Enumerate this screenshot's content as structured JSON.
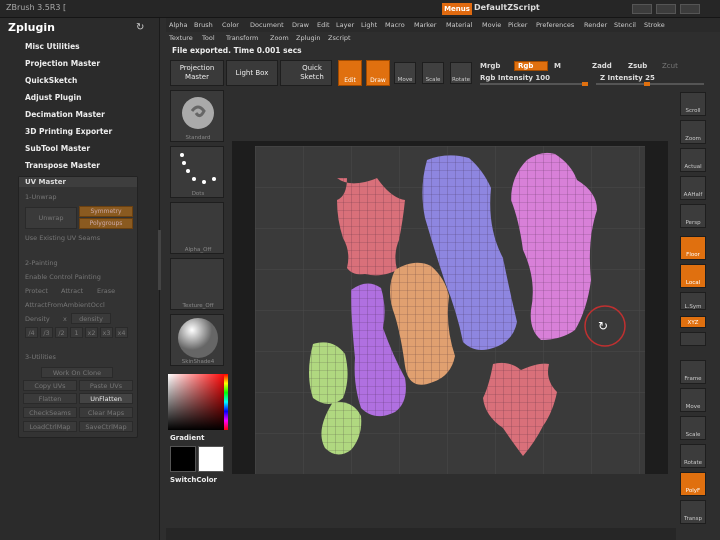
{
  "app": {
    "title": "ZBrush 3.5R3  [",
    "menus": "Menus",
    "defaultz": "DefaultZScript"
  },
  "sidebar": {
    "title": "Zplugin",
    "items": [
      "Misc Utilities",
      "Projection Master",
      "QuickSketch",
      "Adjust Plugin",
      "Decimation Master",
      "3D Printing Exporter",
      "SubTool Master",
      "Transpose Master"
    ]
  },
  "uv": {
    "title": "UV Master",
    "section1": "1-Unwrap",
    "unwrap": "Unwrap",
    "symmetry": "Symmetry",
    "polygroups": "Polygroups",
    "use_existing": "Use Existing UV Seams",
    "section2": "2-Painting",
    "enable_cp": "Enable Control Painting",
    "protect": "Protect",
    "attract": "Attract",
    "erase": "Erase",
    "attract_ao": "AttractFromAmbientOccl",
    "density": "Density",
    "x": "x",
    "density2": "density",
    "density_vals": [
      "/4",
      "/3",
      "/2",
      "1",
      "x2",
      "x3",
      "x4"
    ],
    "section3": "3-Utilities",
    "work_on_clone": "Work On Clone",
    "copy_uvs": "Copy UVs",
    "paste_uvs": "Paste UVs",
    "flatten": "Flatten",
    "unflatten": "UnFlatten",
    "checkseams": "CheckSeams",
    "clear_maps": "Clear Maps",
    "loadctrl": "LoadCtrlMap",
    "savectrl": "SaveCtrlMap"
  },
  "menu1": [
    "Alpha",
    "Brush",
    "Color",
    "Document",
    "Draw",
    "Edit",
    "Layer",
    "Light",
    "Macro",
    "Marker",
    "Material",
    "Movie",
    "Picker",
    "Preferences",
    "Render",
    "Stencil",
    "Stroke"
  ],
  "menu2": [
    "Texture",
    "Tool",
    "Transform",
    "Zoom",
    "Zplugin",
    "Zscript"
  ],
  "status": "File exported. Time 0.001 secs",
  "toolbar": {
    "projection": "Projection\nMaster",
    "lightbox": "Light Box",
    "quicksketch": "Quick\nSketch",
    "edit": "Edit",
    "draw": "Draw",
    "move": "Move",
    "scale": "Scale",
    "rotate": "Rotate",
    "mrgb": "Mrgb",
    "rgb": "Rgb",
    "m": "M",
    "zadd": "Zadd",
    "zsub": "Zsub",
    "zcut": "Zcut",
    "rgb_int": "Rgb Intensity 100",
    "z_int": "Z Intensity 25"
  },
  "tray": {
    "standard": "Standard",
    "dots": "Dots",
    "alpha_off": "Alpha_Off",
    "texture_off": "Texture_Off",
    "skinshade": "SkinShade4",
    "gradient": "Gradient",
    "switchcolor": "SwitchColor"
  },
  "right": [
    "Scroll",
    "Zoom",
    "Actual",
    "AAHalf",
    "Persp",
    "Floor",
    "Local",
    "L.Sym",
    "XYZ",
    "",
    "Frame",
    "Move",
    "Scale",
    "Rotate",
    "PolyF",
    "Transp"
  ],
  "colors": {
    "accent": "#e0700f",
    "uv_red": "#d9707a",
    "uv_purple": "#8e86e0",
    "uv_orange": "#e0a070",
    "uv_pink": "#d880d8",
    "uv_green": "#b0d880",
    "uv_violet": "#b070e0"
  }
}
